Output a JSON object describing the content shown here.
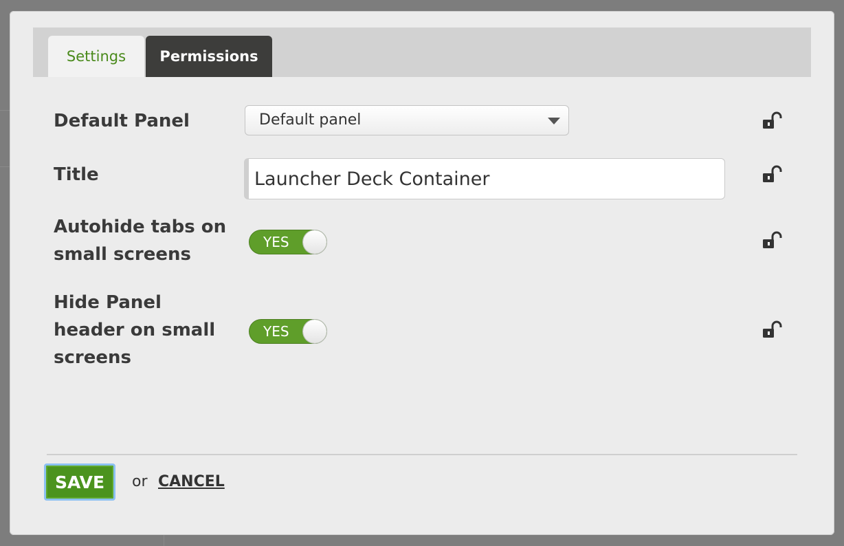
{
  "tabs": [
    {
      "label": "Settings",
      "active": true
    },
    {
      "label": "Permissions",
      "active": false
    }
  ],
  "fields": {
    "default_panel": {
      "label": "Default Panel",
      "value": "Default panel"
    },
    "title": {
      "label": "Title",
      "value": "Launcher Deck Container"
    },
    "autohide_tabs": {
      "label_line1": "Autohide tabs on",
      "label_line2": "small screens",
      "toggle_text": "YES",
      "on": true
    },
    "hide_panel_header": {
      "label_line1": "Hide Panel",
      "label_line2": "header on small",
      "label_line3": "screens",
      "toggle_text": "YES",
      "on": true
    }
  },
  "actions": {
    "save_label": "SAVE",
    "or_label": "or",
    "cancel_label": "CANCEL"
  },
  "icons": {
    "lock": "unlocked-padlock-icon",
    "dropdown": "chevron-down-icon"
  },
  "colors": {
    "accent_green": "#5f9e2a",
    "tab_dark": "#3d3d3b",
    "active_tab_text": "#4a8a1c",
    "focus_ring": "#8cc1f2"
  }
}
